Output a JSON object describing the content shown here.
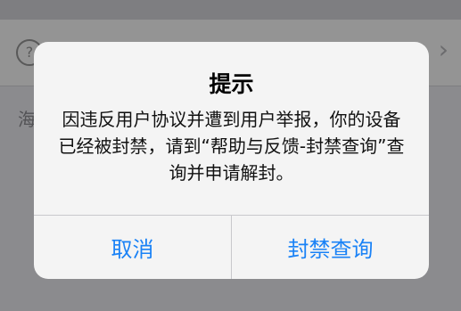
{
  "background": {
    "row_label": "...",
    "hint_text": "海"
  },
  "alert": {
    "title": "提示",
    "message": "因违反用户协议并遭到用户举报，你的设备已经被封禁，请到“帮助与反馈-封禁查询”查询并申请解封。",
    "cancel_label": "取消",
    "confirm_label": "封禁查询"
  },
  "colors": {
    "button_text": "#1a82f6",
    "dialog_background": "#f4f4f4",
    "divider": "#c8c8cc"
  },
  "icons": {
    "background_row_icon": "help-circle-icon",
    "background_row_chevron": "chevron-right-icon"
  }
}
